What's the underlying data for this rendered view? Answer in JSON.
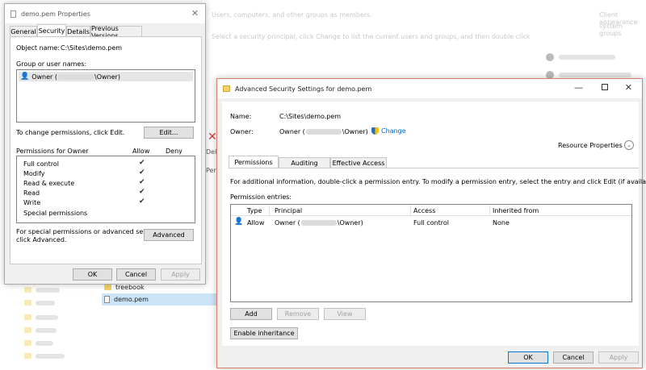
{
  "background": {
    "header_text": "Users, computers, and other groups as members.",
    "header_text2": "Select a security principal, click Change to list the current users and groups, and then double click",
    "right_text1": "Client appearance",
    "right_text2": "system groups",
    "delete_label": "Deleted",
    "permission_label": "Permissions",
    "files": [
      {
        "name": "treebook",
        "type": "folder"
      },
      {
        "name": "demo.pem",
        "type": "file"
      }
    ]
  },
  "properties": {
    "title": "demo.pem Properties",
    "tabs": [
      "General",
      "Security",
      "Details",
      "Previous Versions"
    ],
    "active_tab": "Security",
    "object_name_label": "Object name:",
    "object_name_value": "C:\\Sites\\demo.pem",
    "group_label": "Group or user names:",
    "owner_prefix": "Owner (",
    "owner_suffix": "\\Owner)",
    "change_text": "To change permissions, click Edit.",
    "edit_button": "Edit...",
    "perms_for_label": "Permissions for Owner",
    "allow_label": "Allow",
    "deny_label": "Deny",
    "permissions": [
      {
        "name": "Full control",
        "allow": true
      },
      {
        "name": "Modify",
        "allow": true
      },
      {
        "name": "Read & execute",
        "allow": true
      },
      {
        "name": "Read",
        "allow": true
      },
      {
        "name": "Write",
        "allow": true
      },
      {
        "name": "Special permissions",
        "allow": false
      }
    ],
    "special_text_1": "For special permissions or advanced settings,",
    "special_text_2": "click Advanced.",
    "advanced_button": "Advanced",
    "ok_button": "OK",
    "cancel_button": "Cancel",
    "apply_button": "Apply"
  },
  "advanced": {
    "title": "Advanced Security Settings for demo.pem",
    "name_label": "Name:",
    "name_value": "C:\\Sites\\demo.pem",
    "owner_label": "Owner:",
    "owner_prefix": "Owner (",
    "owner_suffix": "\\Owner)",
    "change_link": "Change",
    "resource_properties": "Resource Properties",
    "tabs": [
      "Permissions",
      "Auditing",
      "Effective Access"
    ],
    "active_tab": "Permissions",
    "info_text": "For additional information, double-click a permission entry. To modify a permission entry, select the entry and click Edit (if available).",
    "entries_label": "Permission entries:",
    "columns": [
      "Type",
      "Principal",
      "Access",
      "Inherited from"
    ],
    "rows": [
      {
        "type": "Allow",
        "principal_prefix": "Owner (",
        "principal_suffix": "\\Owner)",
        "access": "Full control",
        "inherited": "None"
      }
    ],
    "add_button": "Add",
    "remove_button": "Remove",
    "view_button": "View",
    "enable_inheritance_button": "Enable inheritance",
    "ok_button": "OK",
    "cancel_button": "Cancel",
    "apply_button": "Apply"
  },
  "colors": {
    "accent": "#0078d7",
    "link": "#0066cc",
    "close_red": "#c42b1c"
  }
}
